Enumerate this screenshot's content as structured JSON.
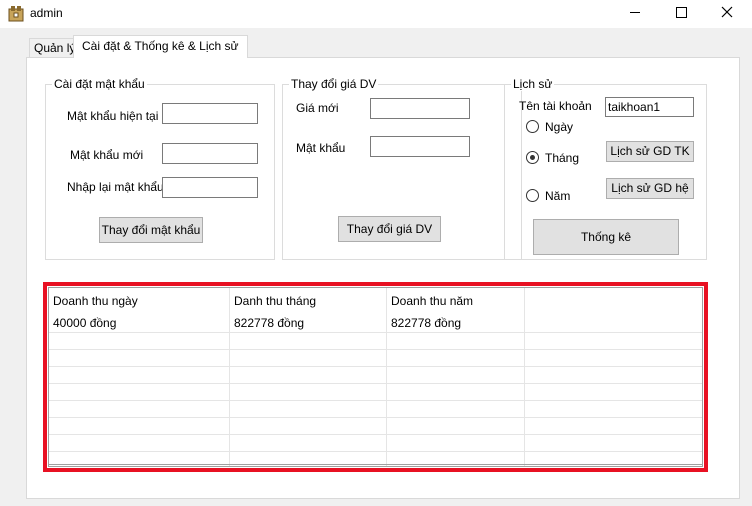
{
  "window": {
    "title": "admin"
  },
  "tabs": [
    {
      "label": "Quản lý"
    },
    {
      "label": "Cài đặt & Thống kê & Lịch sử"
    }
  ],
  "password_group": {
    "legend": "Cài đặt mật khẩu",
    "current_label": "Mật khẩu hiện tại",
    "current_value": "",
    "new_label": "Mật khẩu mới",
    "new_value": "",
    "confirm_label": "Nhập lại mật khẩu",
    "confirm_value": "",
    "button": "Thay đổi mật khẩu"
  },
  "price_group": {
    "legend": "Thay đổi giá DV",
    "price_label": "Giá mới",
    "price_value": "",
    "password_label": "Mật khẩu",
    "password_value": "",
    "button": "Thay đổi giá DV"
  },
  "history_group": {
    "legend": "Lịch sử",
    "account_label": "Tên tài khoản",
    "account_value": "taikhoan1",
    "radios": [
      {
        "label": "Ngày",
        "checked": false
      },
      {
        "label": "Tháng",
        "checked": true
      },
      {
        "label": "Năm",
        "checked": false
      }
    ],
    "btn_account_history": "Lịch sử GD TK",
    "btn_system_history": "Lịch sử GD hệ",
    "btn_stats": "Thống kê"
  },
  "stats_grid": {
    "columns": [
      "Doanh thu ngày",
      "Danh thu tháng",
      "Doanh thu năm"
    ],
    "rows": [
      [
        "40000 đồng",
        "822778 đồng",
        "822778 đồng"
      ]
    ]
  },
  "colors": {
    "highlight_border": "#e81123"
  }
}
